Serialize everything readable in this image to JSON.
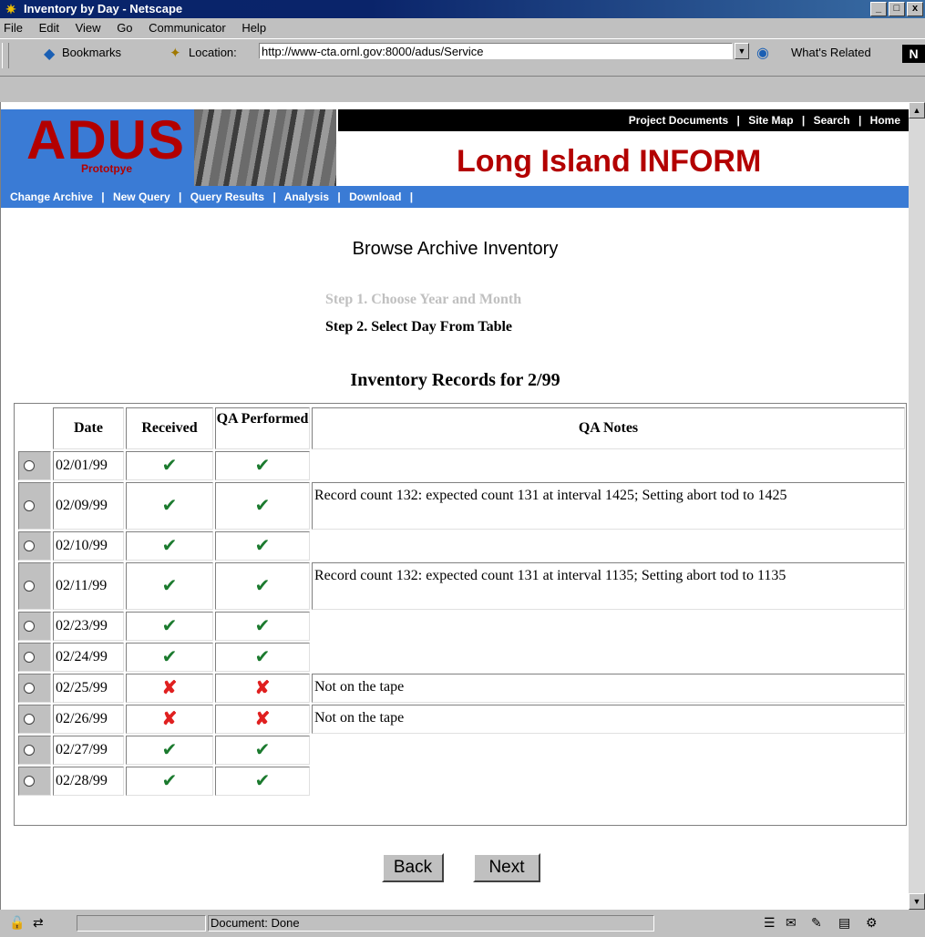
{
  "window": {
    "title": "Inventory by Day - Netscape",
    "buttons": [
      "_",
      "□",
      "x"
    ]
  },
  "menubar": [
    "File",
    "Edit",
    "View",
    "Go",
    "Communicator",
    "Help"
  ],
  "toolbar": {
    "bookmarks_label": "Bookmarks",
    "location_label": "Location:",
    "url": "http://www-cta.ornl.gov:8000/adus/Service",
    "whats_related_label": "What's Related",
    "n_logo": "N"
  },
  "site": {
    "logo_big": "ADUS",
    "logo_small": "Prototpye",
    "top_nav": [
      "Project Documents",
      "Site Map",
      "Search",
      "Home"
    ],
    "title": "Long Island INFORM",
    "sub_nav": [
      "Change Archive",
      "New Query",
      "Query Results",
      "Analysis",
      "Download"
    ],
    "separator": "|"
  },
  "page": {
    "heading": "Browse Archive Inventory",
    "step1": "Step 1. Choose Year and Month",
    "step2": "Step 2. Select Day From Table",
    "inventory_heading": "Inventory Records for 2/99"
  },
  "table": {
    "headers": {
      "date": "Date",
      "received": "Received",
      "qa_performed": "QA Performed",
      "qa_notes": "QA Notes"
    },
    "rows": [
      {
        "date": "02/01/99",
        "received": "✔",
        "qa": "✔",
        "notes": ""
      },
      {
        "date": "02/09/99",
        "received": "✔",
        "qa": "✔",
        "notes": "Record count 132: expected count 131 at interval 1425; Setting abort tod to 1425"
      },
      {
        "date": "02/10/99",
        "received": "✔",
        "qa": "✔",
        "notes": ""
      },
      {
        "date": "02/11/99",
        "received": "✔",
        "qa": "✔",
        "notes": "Record count 132: expected count 131 at interval 1135; Setting abort tod to 1135"
      },
      {
        "date": "02/23/99",
        "received": "✔",
        "qa": "✔",
        "notes": ""
      },
      {
        "date": "02/24/99",
        "received": "✔",
        "qa": "✔",
        "notes": ""
      },
      {
        "date": "02/25/99",
        "received": "✘",
        "qa": "✘",
        "notes": "Not on the tape"
      },
      {
        "date": "02/26/99",
        "received": "✘",
        "qa": "✘",
        "notes": "Not on the tape"
      },
      {
        "date": "02/27/99",
        "received": "✔",
        "qa": "✔",
        "notes": ""
      },
      {
        "date": "02/28/99",
        "received": "✔",
        "qa": "✔",
        "notes": ""
      }
    ]
  },
  "buttons": {
    "back": "Back",
    "next": "Next"
  },
  "status": {
    "text": "Document: Done"
  },
  "colors": {
    "accent_blue": "#3a7bd5",
    "brand_red": "#b30000",
    "check_green": "#1b7a2e",
    "cross_red": "#e02020"
  }
}
